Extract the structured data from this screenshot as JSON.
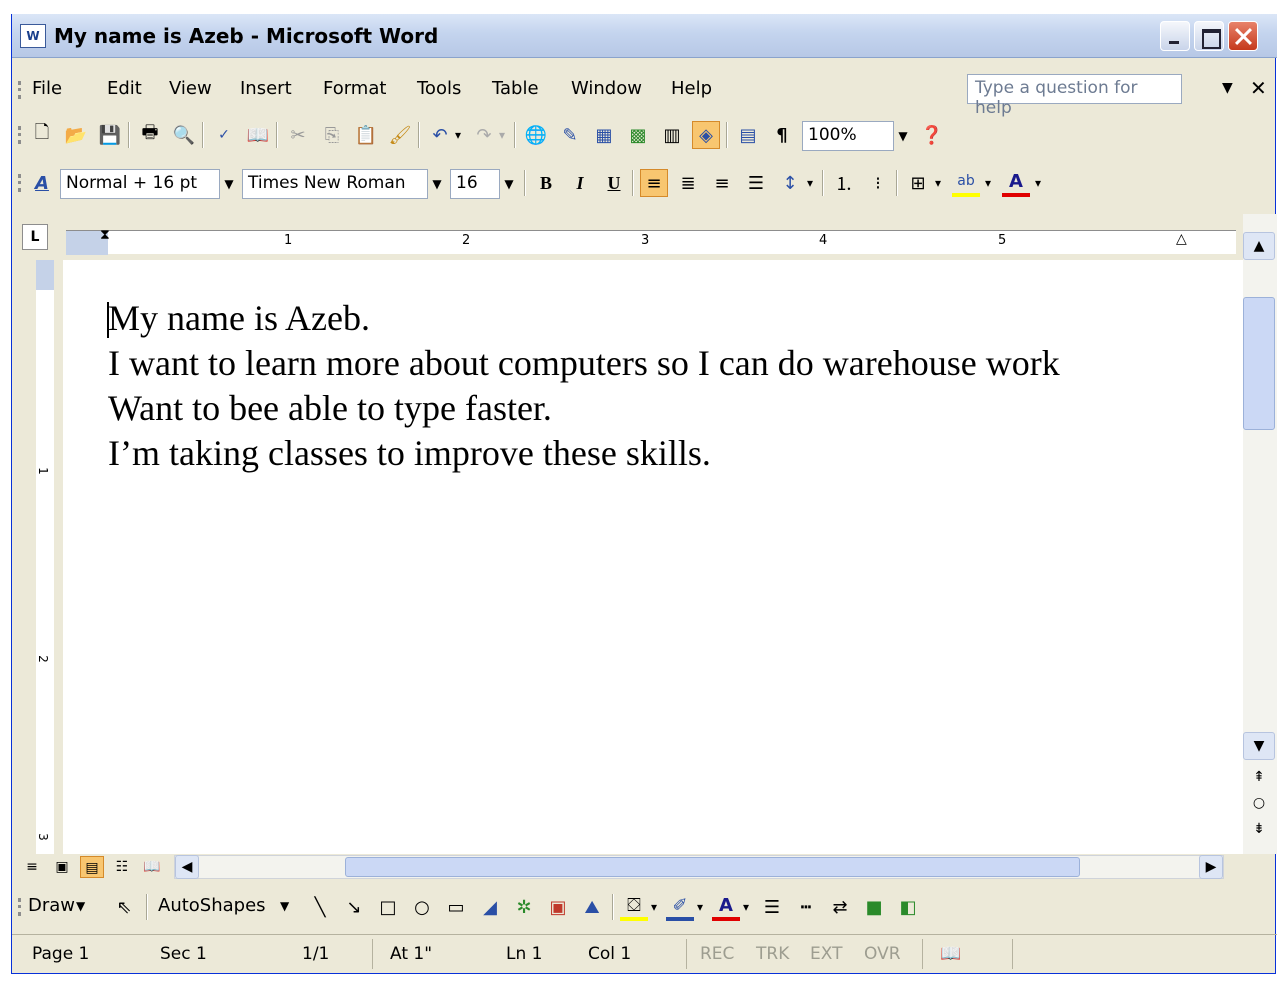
{
  "window": {
    "title": "My name is Azeb - Microsoft Word"
  },
  "menus": [
    "File",
    "Edit",
    "View",
    "Insert",
    "Format",
    "Tools",
    "Table",
    "Window",
    "Help"
  ],
  "help_box": {
    "placeholder": "Type a question for help"
  },
  "standard_toolbar": {
    "icons": [
      "new-icon",
      "open-icon",
      "save-icon",
      "print-icon",
      "print-preview-icon",
      "spelling-icon",
      "research-icon",
      "cut-icon",
      "copy-icon",
      "paste-icon",
      "format-painter-icon",
      "undo-icon",
      "redo-icon",
      "hyperlink-icon",
      "drawing-icon",
      "insert-table-icon",
      "insert-excel-icon",
      "columns-icon",
      "drawing-toggle-icon",
      "document-map-icon",
      "show-formatting-icon",
      "help-icon"
    ],
    "zoom": "100%"
  },
  "formatting_toolbar": {
    "style": "Normal + 16 pt",
    "font": "Times New Roman",
    "size": "16",
    "bold": "B",
    "italic": "I",
    "underline": "U"
  },
  "ruler": {
    "numbers": [
      "1",
      "2",
      "3",
      "4",
      "5"
    ],
    "vnumbers": [
      "1",
      "2",
      "3"
    ]
  },
  "document": {
    "lines": [
      "My name is Azeb.",
      "I want to learn more about computers so I can do warehouse work",
      "Want to bee able to type faster.",
      "I’m taking classes to improve these skills."
    ]
  },
  "draw_toolbar": {
    "draw_label": "Draw",
    "autoshapes_label": "AutoShapes"
  },
  "status": {
    "page": "Page  1",
    "sec": "Sec  1",
    "pages": "1/1",
    "at": "At  1\"",
    "ln": "Ln  1",
    "col": "Col  1",
    "rec": "REC",
    "trk": "TRK",
    "ext": "EXT",
    "ovr": "OVR"
  },
  "colors": {
    "title_bar": "#c4d4ee",
    "accent_active": "#f8c670",
    "highlight_yellow": "#ffff00",
    "font_red": "#e00000"
  }
}
